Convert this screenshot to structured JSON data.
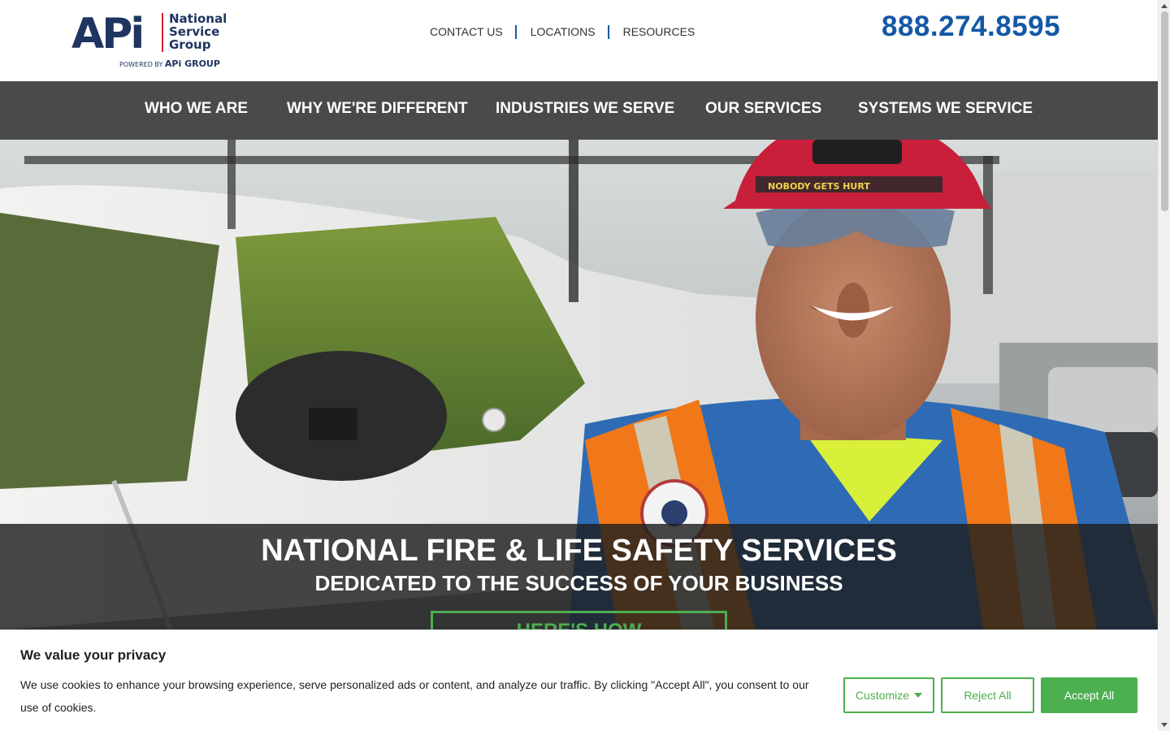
{
  "brand": {
    "logo_mark": "APi",
    "logo_line1": "National",
    "logo_line2": "Service",
    "logo_line3": "Group",
    "powered_by": "POWERED BY",
    "powered_by_brand": "APi GROUP",
    "accent_blue": "#1458a6",
    "accent_red": "#d6202f",
    "accent_green": "#4caf50"
  },
  "utility_nav": {
    "items": [
      {
        "label": "CONTACT US"
      },
      {
        "label": "LOCATIONS"
      },
      {
        "label": "RESOURCES"
      }
    ]
  },
  "phone": "888.274.8595",
  "main_nav": {
    "items": [
      {
        "label": "WHO WE ARE"
      },
      {
        "label": "WHY WE'RE DIFFERENT"
      },
      {
        "label": "INDUSTRIES WE SERVE"
      },
      {
        "label": "OUR SERVICES"
      },
      {
        "label": "SYSTEMS WE SERVICE"
      }
    ]
  },
  "hero": {
    "helmet_text": "NOBODY GETS HURT",
    "title": "NATIONAL FIRE & LIFE SAFETY SERVICES",
    "subtitle": "DEDICATED TO THE SUCCESS OF YOUR BUSINESS",
    "cta_label": "HERE'S HOW"
  },
  "cookie_banner": {
    "title": "We value your privacy",
    "text": "We use cookies to enhance your browsing experience, serve personalized ads or content, and analyze our traffic. By clicking \"Accept All\", you consent to our use of cookies.",
    "customize_label": "Customize",
    "reject_label": "Reject All",
    "accept_label": "Accept All"
  }
}
